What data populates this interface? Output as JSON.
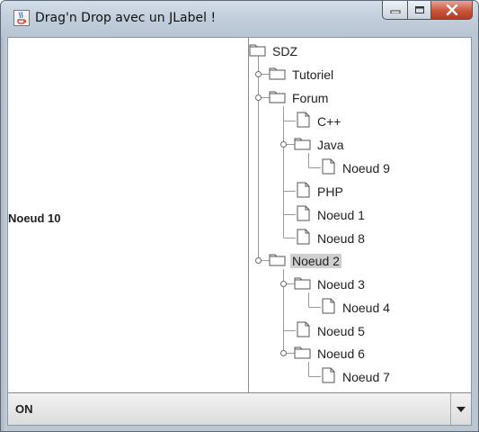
{
  "window": {
    "title": "Drag'n Drop avec un JLabel !",
    "icon": "java-cup-icon",
    "buttons": [
      "minimize-icon",
      "maximize-icon",
      "close-icon"
    ]
  },
  "left_panel": {
    "label": "Noeud 10"
  },
  "tree": {
    "root": "SDZ",
    "nodes": [
      {
        "label": "SDZ",
        "type": "folder"
      },
      {
        "label": "Tutoriel",
        "type": "folder"
      },
      {
        "label": "Forum",
        "type": "folder"
      },
      {
        "label": "C++",
        "type": "file"
      },
      {
        "label": "Java",
        "type": "folder"
      },
      {
        "label": "Noeud 9",
        "type": "file"
      },
      {
        "label": "PHP",
        "type": "file"
      },
      {
        "label": "Noeud 1",
        "type": "file"
      },
      {
        "label": "Noeud 8",
        "type": "file"
      },
      {
        "label": "Noeud 2",
        "type": "folder",
        "selected": true
      },
      {
        "label": "Noeud 3",
        "type": "folder"
      },
      {
        "label": "Noeud 4",
        "type": "file"
      },
      {
        "label": "Noeud 5",
        "type": "file"
      },
      {
        "label": "Noeud 6",
        "type": "folder"
      },
      {
        "label": "Noeud 7",
        "type": "file"
      }
    ]
  },
  "combo": {
    "selected": "ON",
    "arrow_icon": "chevron-down-icon"
  },
  "colors": {
    "selection": "#cfcfcf",
    "close_button": "#c8553e",
    "title_bar": "#c3cfdc"
  }
}
